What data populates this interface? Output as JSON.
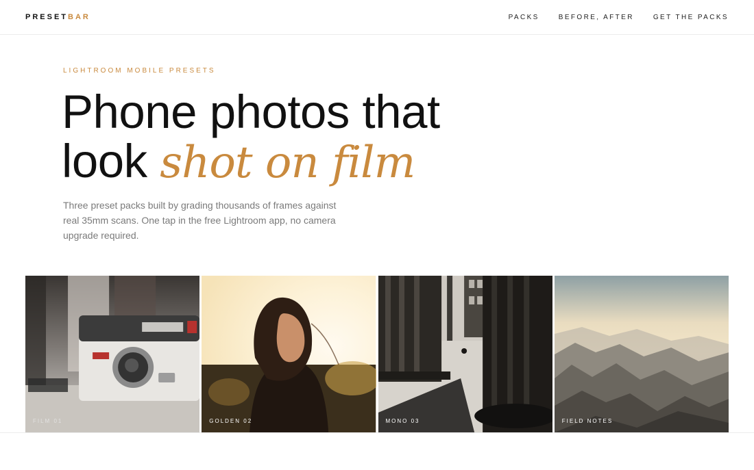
{
  "header": {
    "logo_part1": "PRESET",
    "logo_part2": "BAR",
    "nav": [
      "PACKS",
      "BEFORE, AFTER",
      "GET THE PACKS"
    ]
  },
  "hero": {
    "eyebrow": "LIGHTROOM MOBILE PRESETS",
    "headline_line1": "Phone photos that",
    "headline_line2_plain": "look ",
    "headline_line2_accent": "shot on film",
    "lede": "Three preset packs built by grading thousands of frames against real 35mm scans. One tap in the free Lightroom app, no camera upgrade required."
  },
  "gallery": {
    "tiles": [
      {
        "caption": "FILM 01",
        "image": "instamatic camera on table"
      },
      {
        "caption": "GOLDEN 02",
        "image": "woman in golden hour light"
      },
      {
        "caption": "MONO 03",
        "image": "stone columns street scene"
      },
      {
        "caption": "FIELD NOTES",
        "image": "misty mountain range"
      }
    ]
  },
  "colors": {
    "accent": "#c98a3e",
    "text": "#111111",
    "muted": "#7a7a7a"
  }
}
